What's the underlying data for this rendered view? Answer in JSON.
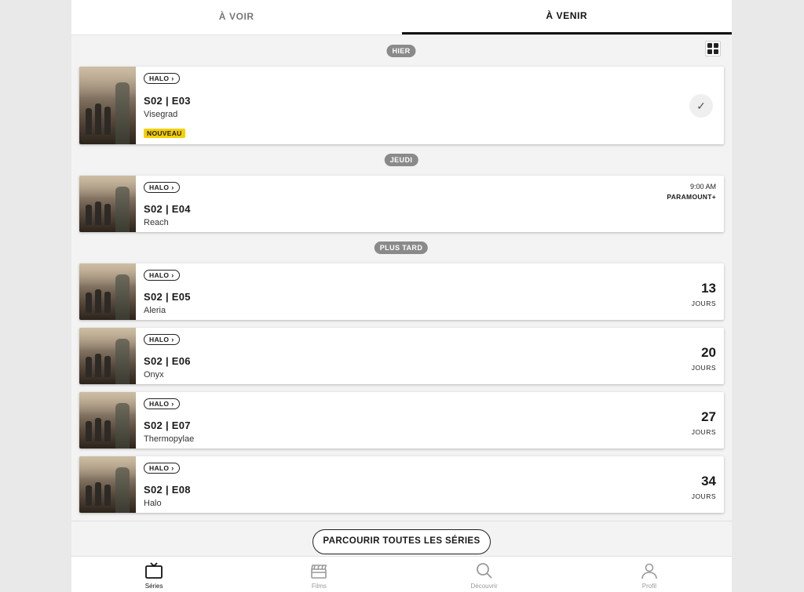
{
  "tabs": {
    "to_watch": "À VOIR",
    "upcoming": "À VENIR"
  },
  "sections": {
    "yesterday": "HIER",
    "thursday": "JEUDI",
    "later": "PLUS TARD"
  },
  "episodes": [
    {
      "show": "HALO",
      "number": "S02 | E03",
      "title": "Visegrad",
      "badge": "NOUVEAU"
    },
    {
      "show": "HALO",
      "number": "S02 | E04",
      "title": "Reach",
      "time": "9:00 AM",
      "network": "PARAMOUNT+"
    },
    {
      "show": "HALO",
      "number": "S02 | E05",
      "title": "Aleria",
      "days": "13",
      "days_unit": "JOURS"
    },
    {
      "show": "HALO",
      "number": "S02 | E06",
      "title": "Onyx",
      "days": "20",
      "days_unit": "JOURS"
    },
    {
      "show": "HALO",
      "number": "S02 | E07",
      "title": "Thermopylae",
      "days": "27",
      "days_unit": "JOURS"
    },
    {
      "show": "HALO",
      "number": "S02 | E08",
      "title": "Halo",
      "days": "34",
      "days_unit": "JOURS"
    }
  ],
  "browse_button": "PARCOURIR TOUTES LES SÉRIES",
  "nav": {
    "series": "Séries",
    "films": "Films",
    "discover": "Découvrir",
    "profile": "Profil"
  },
  "icons": {
    "grid": "grid-view-icon",
    "check": "check-icon",
    "chevron": "chevron-right-icon",
    "tv": "tv-icon",
    "clapper": "clapperboard-icon",
    "search": "search-icon",
    "user": "user-icon"
  },
  "colors": {
    "new_badge": "#f5d000",
    "pill": "#8a8a8a"
  }
}
